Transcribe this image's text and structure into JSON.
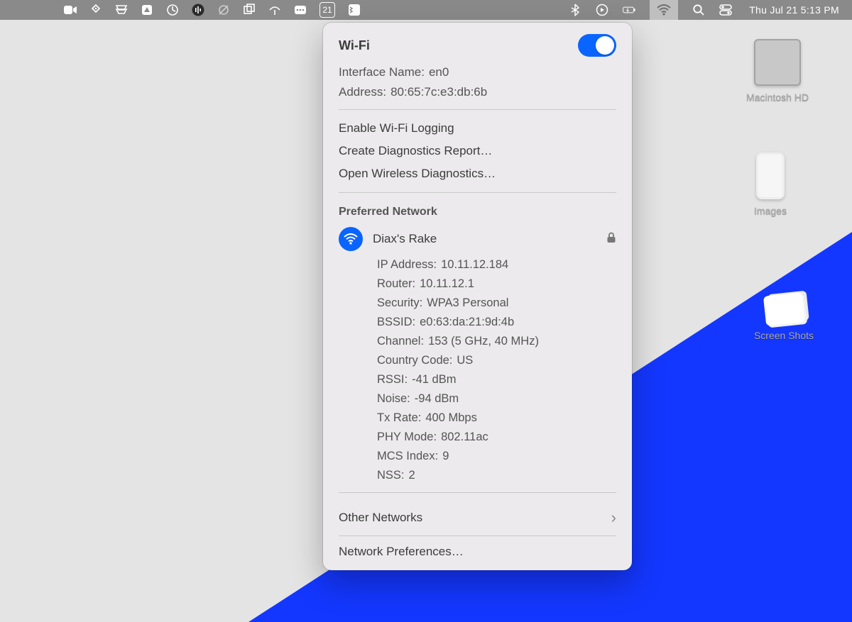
{
  "menubar": {
    "calendar_badge": "21",
    "datetime": "Thu Jul 21  5:13 PM"
  },
  "desktop": {
    "hd": "Macintosh HD",
    "images": "Images",
    "shots": "Screen Shots"
  },
  "wifi_panel": {
    "title": "Wi-Fi",
    "interface_label": "Interface Name:",
    "interface_value": "en0",
    "address_label": "Address:",
    "address_value": "80:65:7c:e3:db:6b",
    "actions": {
      "logging": "Enable Wi-Fi Logging",
      "diag_report": "Create Diagnostics Report…",
      "wireless_diag": "Open Wireless Diagnostics…"
    },
    "preferred_heading": "Preferred Network",
    "network_name": "Diax's Rake",
    "details": [
      {
        "k": "IP Address:",
        "v": "10.11.12.184"
      },
      {
        "k": "Router:",
        "v": "10.11.12.1"
      },
      {
        "k": "Security:",
        "v": "WPA3 Personal"
      },
      {
        "k": "BSSID:",
        "v": "e0:63:da:21:9d:4b"
      },
      {
        "k": "Channel:",
        "v": "153 (5 GHz, 40 MHz)"
      },
      {
        "k": "Country Code:",
        "v": "US"
      },
      {
        "k": "RSSI:",
        "v": "-41 dBm"
      },
      {
        "k": "Noise:",
        "v": "-94 dBm"
      },
      {
        "k": "Tx Rate:",
        "v": "400 Mbps"
      },
      {
        "k": "PHY Mode:",
        "v": "802.11ac"
      },
      {
        "k": "MCS Index:",
        "v": "9"
      },
      {
        "k": "NSS:",
        "v": "2"
      }
    ],
    "other_networks": "Other Networks",
    "network_prefs": "Network Preferences…"
  }
}
